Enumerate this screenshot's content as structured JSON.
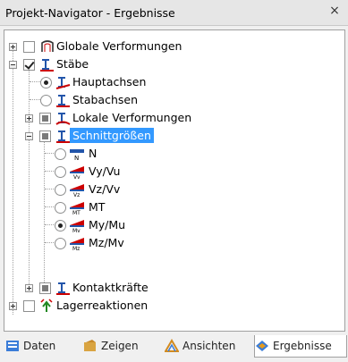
{
  "window": {
    "title": "Projekt-Navigator - Ergebnisse",
    "close_glyph": "×"
  },
  "tree": {
    "globale": "Globale Verformungen",
    "staebe": "Stäbe",
    "hauptachsen": "Hauptachsen",
    "stabachsen": "Stabachsen",
    "lokale": "Lokale Verformungen",
    "schnitt": "Schnittgrößen",
    "n": "N",
    "vy": "Vy/Vu",
    "vz": "Vz/Vv",
    "mt": "MT",
    "my": "My/Mu",
    "mz": "Mz/Mv",
    "kontakt": "Kontaktkräfte",
    "lager": "Lagerreaktionen"
  },
  "tabs": [
    {
      "label": "Daten",
      "icon": "data-icon"
    },
    {
      "label": "Zeigen",
      "icon": "show-icon"
    },
    {
      "label": "Ansichten",
      "icon": "views-icon"
    },
    {
      "label": "Ergebnisse",
      "icon": "results-icon"
    }
  ]
}
